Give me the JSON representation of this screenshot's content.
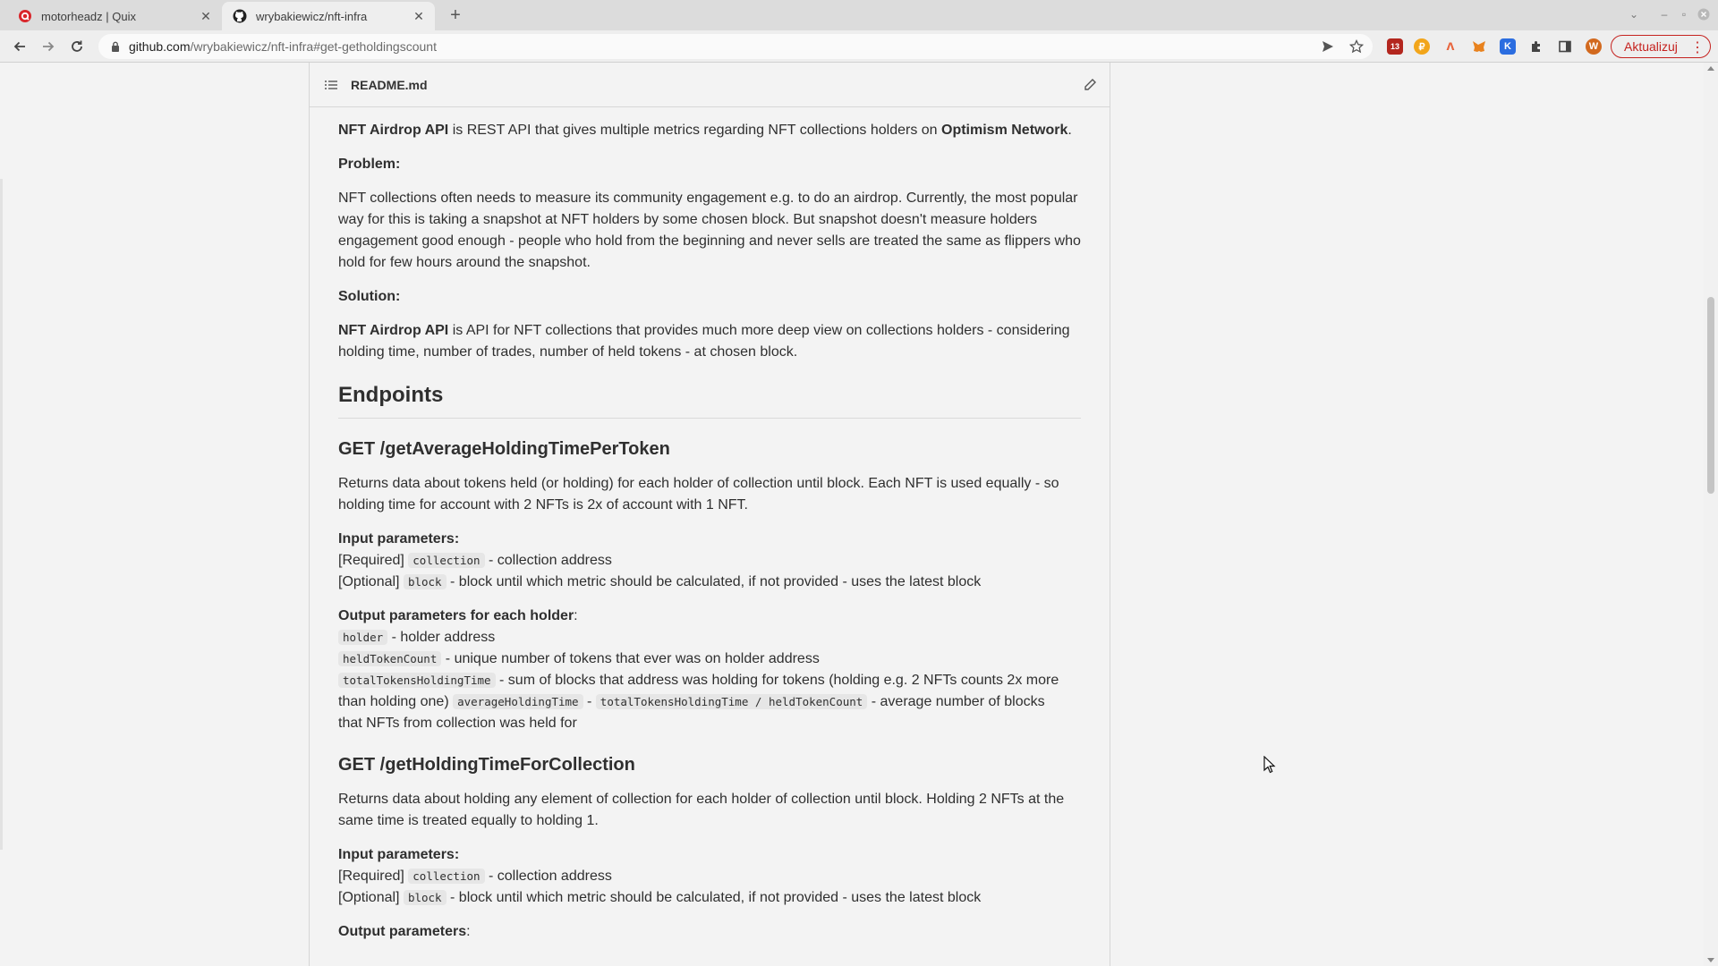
{
  "browser": {
    "tabs": [
      {
        "title": "motorheadz | Quix",
        "active": false
      },
      {
        "title": "wrybakiewicz/nft-infra",
        "active": true
      }
    ],
    "url_host": "github.com",
    "url_path": "/wrybakiewicz/nft-infra#get-getholdingscount",
    "extension_badge": "13",
    "profile_initial": "W",
    "update_label": "Aktualizuj",
    "accent_color": "#c5221f"
  },
  "readme": {
    "file_name": "README.md",
    "intro": {
      "name": "NFT Airdrop API",
      "text": " is REST API that gives multiple metrics regarding NFT collections holders on ",
      "network": "Optimism Network",
      "end": "."
    },
    "problem_heading": "Problem:",
    "problem_lines": [
      "NFT collections often needs to measure its community engagement e.g. to do an airdrop. Currently, the most popular",
      "way for this is taking a snapshot at NFT holders by some chosen block. But snapshot doesn't measure holders",
      "engagement good enough - people who hold from the beginning and never sells are treated the same as flippers who",
      "hold for few hours around the snapshot."
    ],
    "solution_heading": "Solution:",
    "solution": {
      "name": "NFT Airdrop API",
      "line1": " is API for NFT collections that provides much more deep view on collections holders - considering",
      "line2": "holding time, number of trades, number of held tokens - at chosen block."
    },
    "endpoints_heading": "Endpoints",
    "endpoint1": {
      "title": "GET /getAverageHoldingTimePerToken",
      "desc1": "Returns data about tokens held (or holding) for each holder of collection until block. Each NFT is used equally - so",
      "desc2": "holding time for account with 2 NFTs is 2x of account with 1 NFT.",
      "input_heading": "Input parameters:",
      "req_label": "[Required]",
      "req_code": "collection",
      "req_text": " - collection address",
      "opt_label": "[Optional]",
      "opt_code": "block",
      "opt_text": " - block until which metric should be calculated, if not provided - uses the latest block",
      "output_heading": "Output parameters for each holder",
      "output_colon": ":",
      "out1_code": "holder",
      "out1_text": " - holder address",
      "out2_code": "heldTokenCount",
      "out2_text": " - unique number of tokens that ever was on holder address",
      "out3_code": "totalTokensHoldingTime",
      "out3_text": " - sum of blocks that address was holding for tokens (holding e.g. 2 NFTs counts 2x more",
      "out3_text2": "than holding one) ",
      "out4_code": "averageHoldingTime",
      "out4_sep": " - ",
      "out4_formula": "totalTokensHoldingTime / heldTokenCount",
      "out4_text": " - average number of blocks",
      "out4_text2": "that NFTs from collection was held for"
    },
    "endpoint2": {
      "title": "GET /getHoldingTimeForCollection",
      "desc1": "Returns data about holding any element of collection for each holder of collection until block. Holding 2 NFTs at the",
      "desc2": "same time is treated equally to holding 1.",
      "input_heading": "Input parameters:",
      "req_label": "[Required]",
      "req_code": "collection",
      "req_text": " - collection address",
      "opt_label": "[Optional]",
      "opt_code": "block",
      "opt_text": " - block until which metric should be calculated, if not provided - uses the latest block",
      "output_heading": "Output parameters",
      "output_colon": ":"
    }
  }
}
